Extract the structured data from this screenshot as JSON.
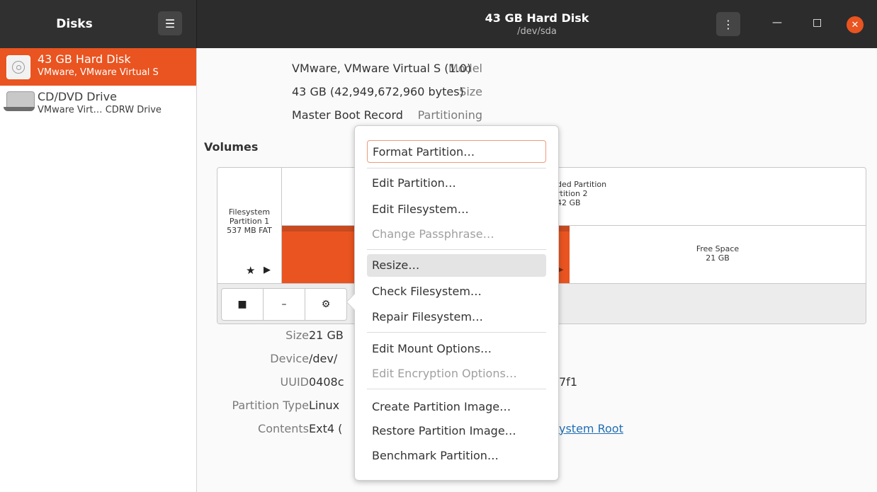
{
  "header": {
    "app_title": "Disks",
    "title": "43 GB Hard Disk",
    "subtitle": "/dev/sda"
  },
  "sidebar": {
    "items": [
      {
        "name": "43 GB Hard Disk",
        "detail": "VMware, VMware Virtual S",
        "icon": "hard-disk-icon",
        "selected": true
      },
      {
        "name": "CD/DVD Drive",
        "detail": "VMware Virt… CDRW Drive",
        "icon": "optical-drive-icon",
        "selected": false
      }
    ]
  },
  "disk_info": {
    "model_label": "Model",
    "model_value": "VMware, VMware Virtual S (1.0)",
    "size_label": "Size",
    "size_value": "43 GB (42,949,672,960 bytes)",
    "partitioning_label": "Partitioning",
    "partitioning_value": "Master Boot Record"
  },
  "volumes": {
    "title": "Volumes",
    "partition1": {
      "line1": "Filesystem",
      "line2": "Partition 1",
      "line3": "537 MB FAT"
    },
    "extended": {
      "line1": "ded Partition",
      "line2": "rtition 2",
      "line3": "42 GB"
    },
    "free_space": {
      "line1": "Free Space",
      "line2": "21 GB"
    },
    "star_glyph": "★",
    "play_glyph": "▶",
    "toolbar": {
      "stop": "■",
      "minus": "–",
      "gears": "⚙"
    }
  },
  "partition_info": {
    "size_label": "Size",
    "size_value": "21 GB",
    "device_label": "Device",
    "device_value": "/dev/",
    "uuid_label": "UUID",
    "uuid_value_left": "0408c",
    "uuid_value_right": "7f1",
    "type_label": "Partition Type",
    "type_value": "Linux",
    "contents_label": "Contents",
    "contents_value": "Ext4 (",
    "contents_link": "ystem Root"
  },
  "context_menu": {
    "items": [
      {
        "label": "Format Partition…",
        "state": "focused"
      },
      {
        "label": "Edit Partition…",
        "state": "normal"
      },
      {
        "label": "Edit Filesystem…",
        "state": "normal"
      },
      {
        "label": "Change Passphrase…",
        "state": "disabled"
      },
      {
        "label": "Resize…",
        "state": "hover"
      },
      {
        "label": "Check Filesystem…",
        "state": "normal"
      },
      {
        "label": "Repair Filesystem…",
        "state": "normal"
      },
      {
        "label": "Edit Mount Options…",
        "state": "normal"
      },
      {
        "label": "Edit Encryption Options…",
        "state": "disabled"
      },
      {
        "label": "Create Partition Image…",
        "state": "normal"
      },
      {
        "label": "Restore Partition Image…",
        "state": "normal"
      },
      {
        "label": "Benchmark Partition…",
        "state": "normal"
      }
    ]
  },
  "colors": {
    "accent": "#e95420",
    "header_bg": "#2c2c2c",
    "link": "#1f6fb4"
  }
}
